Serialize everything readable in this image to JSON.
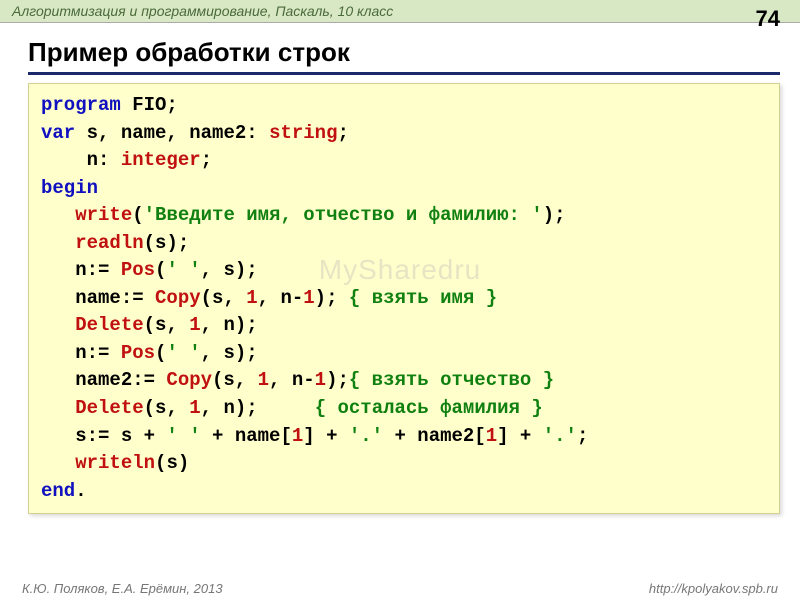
{
  "header": {
    "course": "Алгоритмизация и программирование, Паскаль, 10 класс",
    "page_number": "74"
  },
  "title": "Пример обработки строк",
  "code": {
    "l1": {
      "kw1": "program",
      "id": " FIO;"
    },
    "l2": {
      "kw1": "var",
      "ids": " s, name, name2: ",
      "ty": "string",
      "semi": ";"
    },
    "l3": {
      "pad": "    n: ",
      "ty": "integer",
      "semi": ";"
    },
    "l4": {
      "kw1": "begin"
    },
    "l5": {
      "pad": "   ",
      "fn": "write",
      "open": "(",
      "str": "'Введите имя, отчество и фамилию: '",
      "close": ");"
    },
    "l6": {
      "pad": "   ",
      "fn": "readln",
      "rest": "(s);"
    },
    "l7": {
      "pad": "   n:= ",
      "fn": "Pos",
      "open": "(",
      "str": "' '",
      "rest": ", s);"
    },
    "l8": {
      "pad": "   name:= ",
      "fn": "Copy",
      "args": "(s, ",
      "n1": "1",
      "mid": ", n-",
      "n2": "1",
      "close": "); ",
      "cmt": "{ взять имя }"
    },
    "l9": {
      "pad": "   ",
      "fn": "Delete",
      "args": "(s, ",
      "n1": "1",
      "rest": ", n);"
    },
    "l10": {
      "pad": "   n:= ",
      "fn": "Pos",
      "open": "(",
      "str": "' '",
      "rest": ", s);"
    },
    "l11": {
      "pad": "   name2:= ",
      "fn": "Copy",
      "args": "(s, ",
      "n1": "1",
      "mid": ", n-",
      "n2": "1",
      "close": ");",
      "cmt": "{ взять отчество }"
    },
    "l12": {
      "pad": "   ",
      "fn": "Delete",
      "args": "(s, ",
      "n1": "1",
      "rest": ", n);     ",
      "cmt": "{ осталась фамилия }"
    },
    "l13": {
      "pad": "   s:= s + ",
      "s1": "' '",
      "p1": " + name[",
      "n1": "1",
      "p2": "] + ",
      "s2": "'.'",
      "p3": " + name2[",
      "n2": "1",
      "p4": "] + ",
      "s3": "'.'",
      "semi": ";"
    },
    "l14": {
      "pad": "   ",
      "fn": "writeln",
      "rest": "(s)"
    },
    "l15": {
      "kw1": "end",
      "dot": "."
    }
  },
  "footer": {
    "left": "К.Ю. Поляков, Е.А. Ерёмин, 2013",
    "right": "http://kpolyakov.spb.ru"
  },
  "watermark": "MySharedru"
}
